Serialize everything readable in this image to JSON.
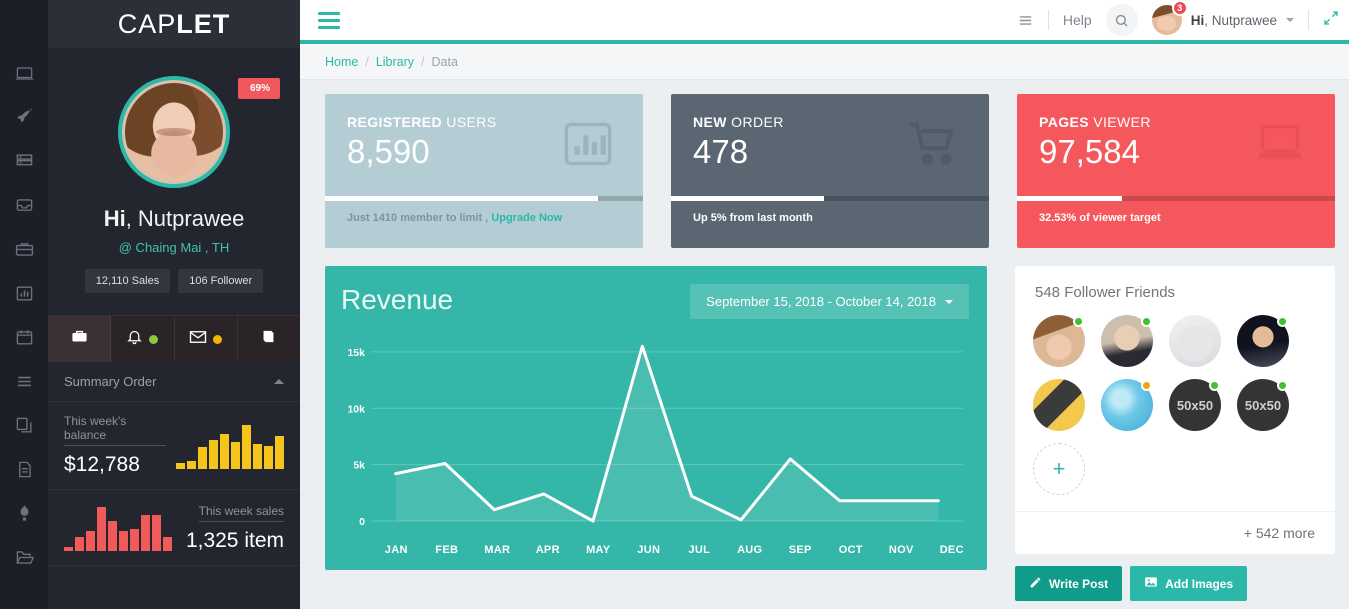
{
  "brand": {
    "light": "CAP",
    "bold": "LET"
  },
  "icon_rail": [
    {
      "name": "laptop-icon"
    },
    {
      "name": "rocket-icon"
    },
    {
      "name": "server-icon"
    },
    {
      "name": "inbox-icon"
    },
    {
      "name": "briefcase-icon"
    },
    {
      "name": "chart-bar-icon"
    },
    {
      "name": "calendar-icon"
    },
    {
      "name": "list-icon"
    },
    {
      "name": "copy-file-icon"
    },
    {
      "name": "document-icon"
    },
    {
      "name": "lamp-icon"
    },
    {
      "name": "folder-open-icon"
    }
  ],
  "profile": {
    "badge": "69%",
    "greeting_bold": "Hi",
    "greeting_rest": ", Nutprawee",
    "location": "@ Chaing Mai , TH",
    "chips": [
      "12,110 Sales",
      "106 Follower"
    ]
  },
  "action_row": [
    {
      "icon": "briefcase-icon",
      "dot": null
    },
    {
      "icon": "bell-icon",
      "dot": "green"
    },
    {
      "icon": "envelope-icon",
      "dot": "amber"
    },
    {
      "icon": "book-icon",
      "dot": null
    }
  ],
  "summary": {
    "header": "Summary Order",
    "balance_label": "This week's balance",
    "balance_value": "$12,788",
    "balance_spark": [
      6,
      8,
      22,
      30,
      36,
      28,
      46,
      26,
      24,
      34
    ],
    "sales_label": "This week sales",
    "sales_value": "1,325 item",
    "sales_spark": [
      4,
      14,
      20,
      44,
      30,
      20,
      22,
      36,
      36,
      14
    ]
  },
  "topbar": {
    "menu_icon": "hamburger-icon",
    "list_icon": "list-icon",
    "help": "Help",
    "search_icon": "search-icon",
    "notification_count": "3",
    "user_bold": "Hi",
    "user_rest": ", Nutprawee",
    "expand_icon": "expand-icon"
  },
  "breadcrumb": {
    "items": [
      "Home",
      "Library",
      "Data"
    ],
    "separator": "/"
  },
  "stat_cards": [
    {
      "title_bold": "REGISTERED",
      "title_rest": " USERS",
      "value": "8,590",
      "icon": "bar-chart-icon",
      "progress": 86,
      "foot_text": "Just 1410 member to limit , ",
      "foot_link": "Upgrade Now",
      "bg": "#b4cdd4"
    },
    {
      "title_bold": "NEW",
      "title_rest": " ORDER",
      "value": "478",
      "icon": "shopping-cart-icon",
      "progress": 48,
      "foot_text": "Up 5% from last month",
      "foot_link": "",
      "bg": "#5a6672"
    },
    {
      "title_bold": "PAGES",
      "title_rest": " VIEWER",
      "value": "97,584",
      "icon": "laptop-icon",
      "progress": 33,
      "foot_text": "32.53% of viewer target",
      "foot_link": "",
      "bg": "#f4585c"
    }
  ],
  "revenue": {
    "title": "Revenue",
    "daterange": "September 15, 2018 - October 14, 2018"
  },
  "chart_data": {
    "type": "line",
    "title": "Revenue",
    "categories": [
      "JAN",
      "FEB",
      "MAR",
      "APR",
      "MAY",
      "JUN",
      "JUL",
      "AUG",
      "SEP",
      "OCT",
      "NOV",
      "DEC"
    ],
    "values": [
      4200,
      5100,
      1000,
      2400,
      0,
      15500,
      2200,
      100,
      5500,
      1800,
      1800,
      1800
    ],
    "ylim": [
      0,
      16500
    ],
    "ytick_values": [
      0,
      5000,
      10000,
      15000
    ],
    "ytick_labels": [
      "0",
      "5k",
      "10k",
      "15k"
    ],
    "xlabel": "",
    "ylabel": "",
    "grid": true,
    "legend": false,
    "line_color": "#ffffff",
    "fill_color": "rgba(255,255,255,0.10)",
    "background": "#34b6a8"
  },
  "followers": {
    "title": "548 Follower Friends",
    "items": [
      {
        "type": "photo",
        "style": "woman-brown-hair",
        "status": "green"
      },
      {
        "type": "photo",
        "style": "older-man",
        "status": "green"
      },
      {
        "type": "photo",
        "style": "faded-woman",
        "status": null
      },
      {
        "type": "photo",
        "style": "man-dark-bg",
        "status": "green"
      },
      {
        "type": "photo",
        "style": "yellow-abstract",
        "status": null
      },
      {
        "type": "photo",
        "style": "blue-sphere",
        "status": "amber"
      },
      {
        "type": "placeholder",
        "label": "50x50",
        "status": "green"
      },
      {
        "type": "placeholder",
        "label": "50x50",
        "status": "green"
      },
      {
        "type": "add",
        "label": "+",
        "status": null
      }
    ],
    "more_label": "+ 542 more",
    "buttons": [
      {
        "label": "Write Post",
        "icon": "pencil-icon"
      },
      {
        "label": "Add Images",
        "icon": "image-icon"
      }
    ]
  },
  "colors": {
    "accent": "#2bb8a8",
    "chart_bg": "#34b6a8",
    "danger": "#f4585c",
    "sidebar": "#23262e",
    "rail": "#1c1f26"
  }
}
